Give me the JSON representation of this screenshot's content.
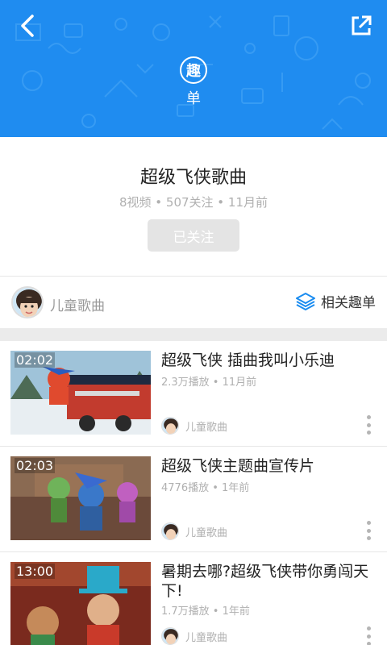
{
  "header": {
    "logo_char": "趣",
    "logo_text": "单"
  },
  "info": {
    "title": "超级飞侠歌曲",
    "meta": "8视频 • 507关注 • 11月前",
    "follow_label": "已关注"
  },
  "author": {
    "name": "儿童歌曲",
    "related_label": "相关趣单"
  },
  "videos": [
    {
      "duration": "02:02",
      "title": "超级飞侠 插曲我叫小乐迪",
      "meta": "2.3万播放 • 11月前",
      "author": "儿童歌曲"
    },
    {
      "duration": "02:03",
      "title": "超级飞侠主题曲宣传片",
      "meta": "4776播放 • 1年前",
      "author": "儿童歌曲"
    },
    {
      "duration": "13:00",
      "title": "暑期去哪?超级飞侠带你勇闯天下!",
      "meta": "1.7万播放 • 1年前",
      "author": "儿童歌曲"
    }
  ],
  "colors": {
    "header_blue": "#1f8cf0",
    "accent_blue": "#1a8cf0"
  },
  "icons": [
    "back-arrow-icon",
    "share-icon",
    "layers-icon",
    "more-vertical-icon"
  ]
}
